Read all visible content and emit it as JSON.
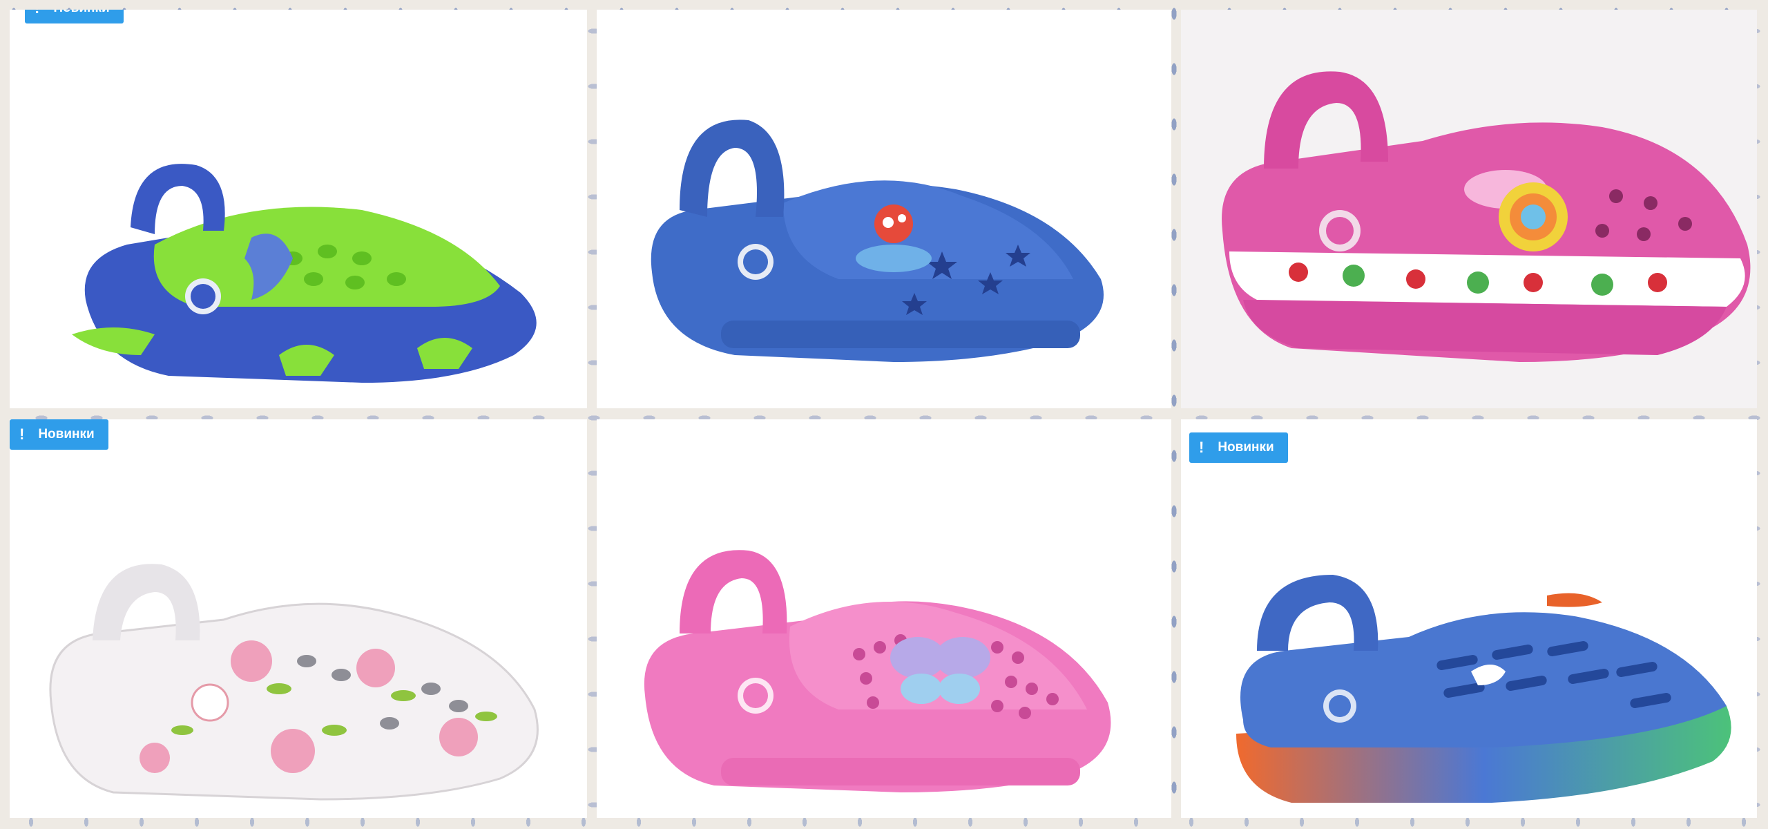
{
  "badge_label": "Новинки",
  "badge_icon": "exclamation-icon",
  "colors": {
    "badge": "#2f9dea",
    "background": "#eeeae4",
    "card": "#ffffff"
  },
  "products": [
    {
      "shoe": "blue-green-shark-clog",
      "badge": true
    },
    {
      "shoe": "blue-star-clog",
      "badge": false
    },
    {
      "shoe": "pink-flower-strawberry-clog",
      "badge": false
    },
    {
      "shoe": "white-floral-clog",
      "badge": true
    },
    {
      "shoe": "pink-butterfly-clog",
      "badge": false
    },
    {
      "shoe": "blue-gradient-sole-clog",
      "badge": true
    }
  ]
}
